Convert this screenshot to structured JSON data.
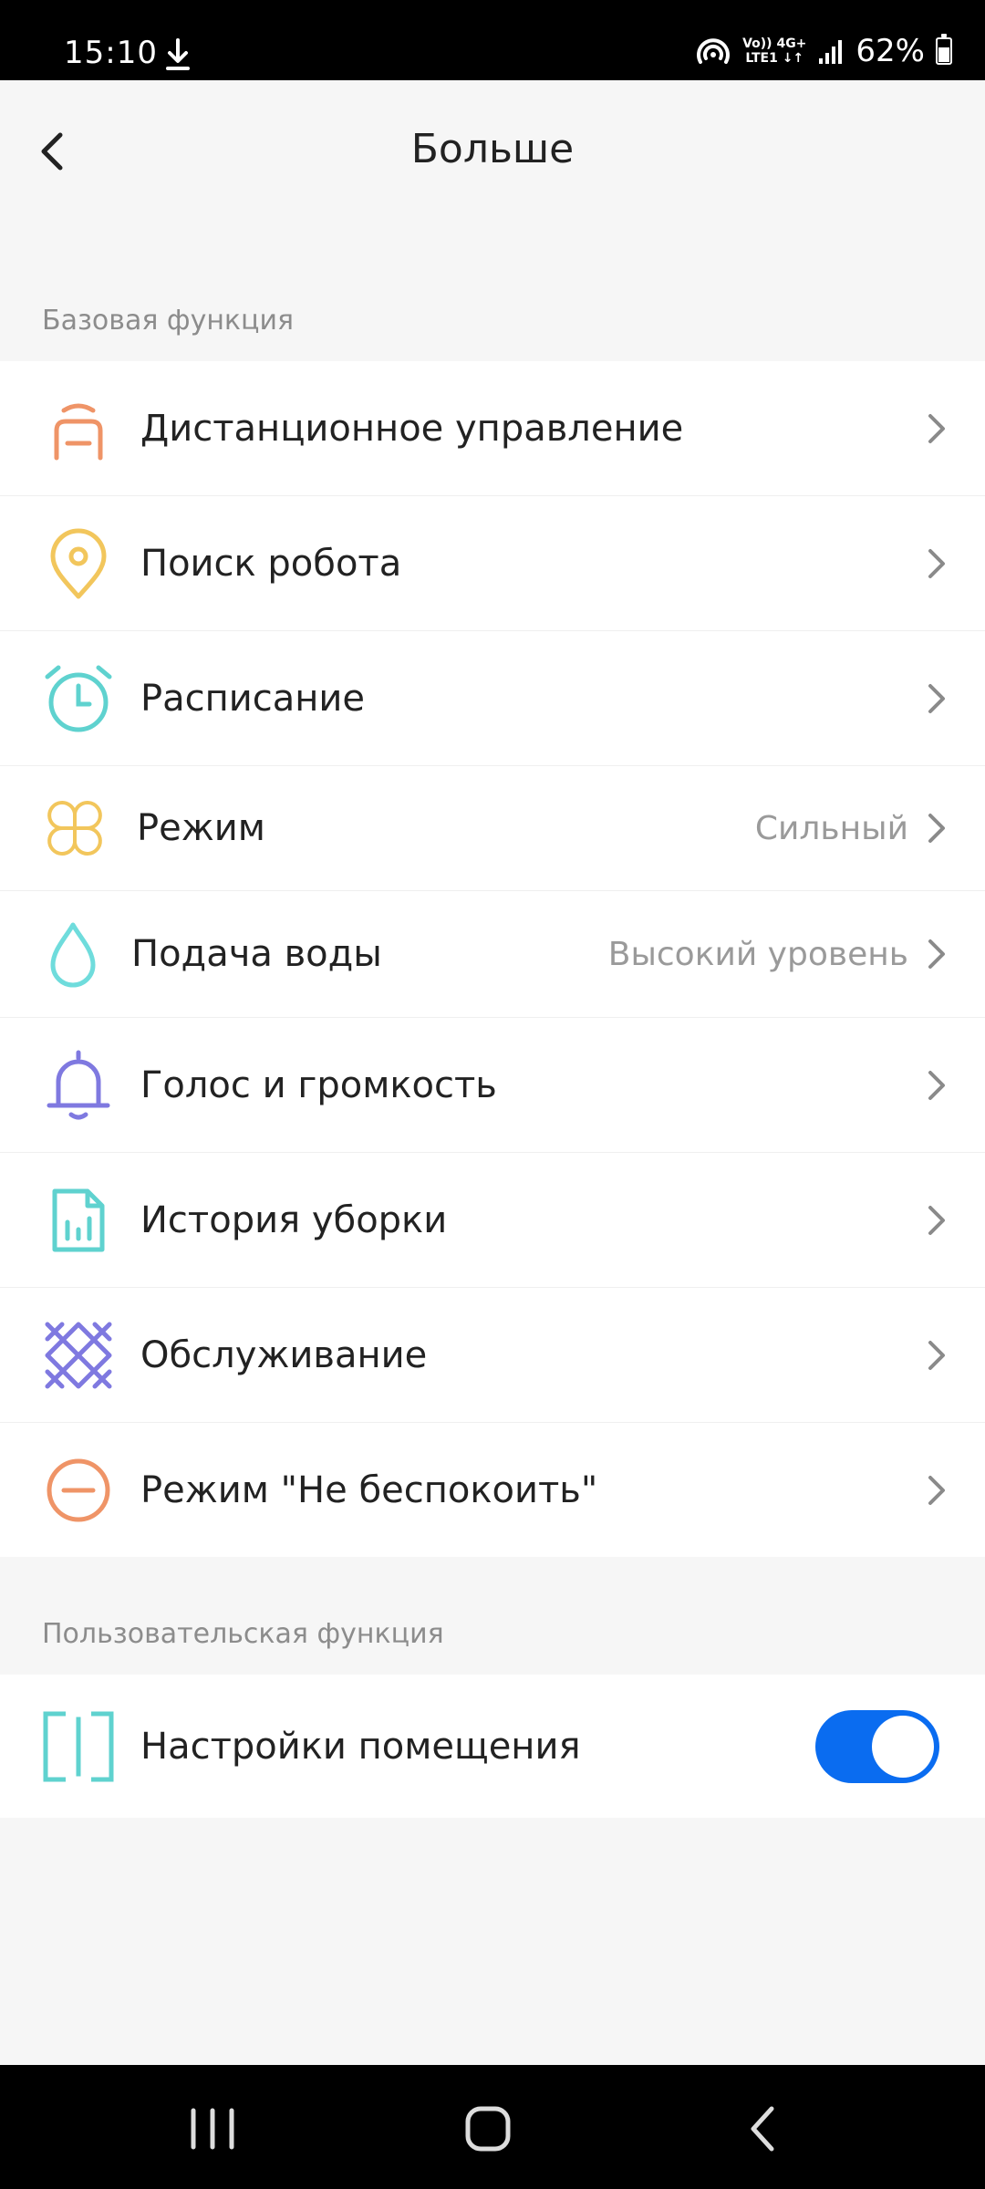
{
  "status_bar": {
    "time": "15:10",
    "network_top": "Vo)) 4G+",
    "network_bottom": "LTE1 ↓↑",
    "battery": "62%"
  },
  "header": {
    "title": "Больше"
  },
  "sections": {
    "basic": {
      "title": "Базовая функция",
      "items": [
        {
          "label": "Дистанционное управление",
          "value": "",
          "icon": "remote-control-icon"
        },
        {
          "label": "Поиск робота",
          "value": "",
          "icon": "location-pin-icon"
        },
        {
          "label": "Расписание",
          "value": "",
          "icon": "alarm-clock-icon"
        },
        {
          "label": "Режим",
          "value": "Сильный",
          "icon": "clover-mode-icon"
        },
        {
          "label": "Подача воды",
          "value": "Высокий уровень",
          "icon": "water-drop-icon"
        },
        {
          "label": "Голос и громкость",
          "value": "",
          "icon": "bell-icon"
        },
        {
          "label": "История уборки",
          "value": "",
          "icon": "report-document-icon"
        },
        {
          "label": "Обслуживание",
          "value": "",
          "icon": "maintenance-icon"
        },
        {
          "label": "Режим \"Не беспокоить\"",
          "value": "",
          "icon": "do-not-disturb-icon"
        }
      ]
    },
    "custom": {
      "title": "Пользовательская функция",
      "items": [
        {
          "label": "Настройки помещения",
          "toggle_on": true,
          "icon": "room-settings-icon"
        }
      ]
    }
  },
  "colors": {
    "accent_toggle": "#0a6cf0",
    "orange": "#ef9467",
    "yellow": "#f2c65c",
    "teal": "#5fd2cf",
    "purple": "#7f79e0"
  }
}
